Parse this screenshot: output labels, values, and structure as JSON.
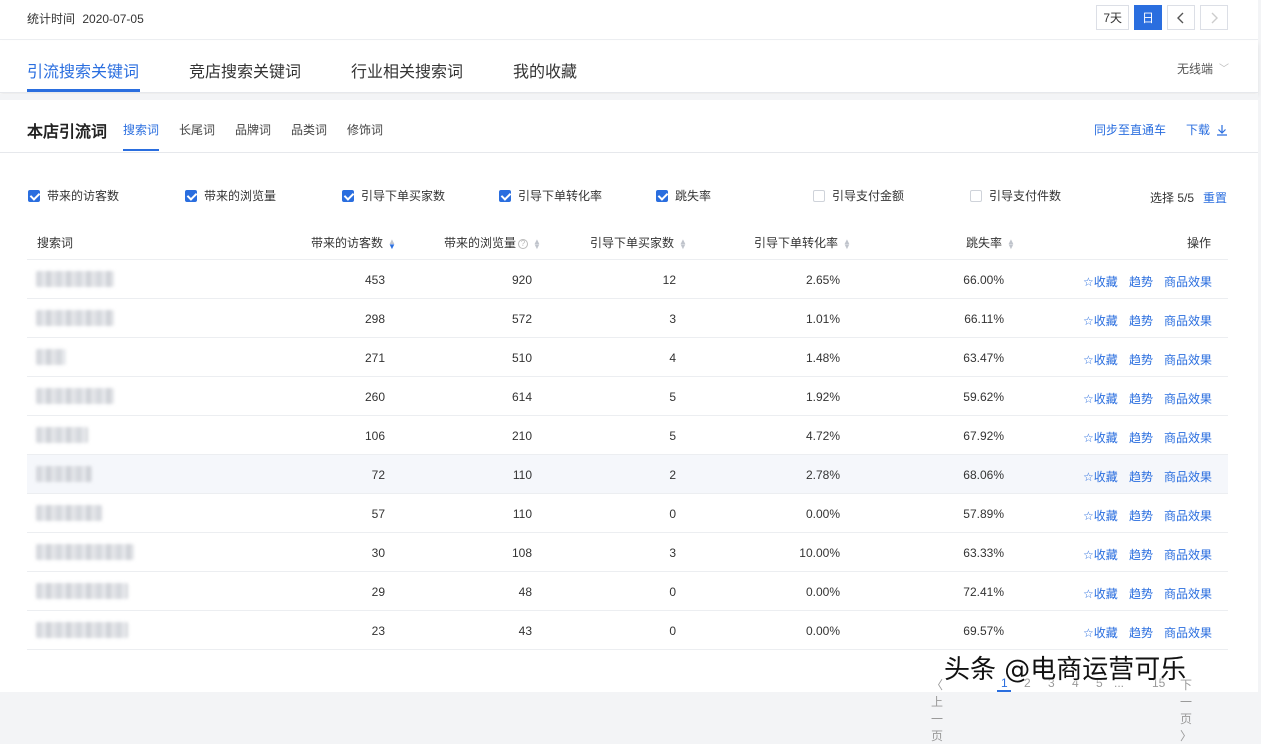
{
  "topbar": {
    "stat_label": "统计时间",
    "stat_date": "2020-07-05",
    "range_buttons": [
      "7天",
      "日"
    ],
    "active_range": "日",
    "prev_icon": "chevron-left-icon",
    "next_icon": "chevron-right-icon"
  },
  "main_tabs": [
    "引流搜索关键词",
    "竞店搜索关键词",
    "行业相关搜索词",
    "我的收藏"
  ],
  "main_tab_active": "引流搜索关键词",
  "device_select": "无线端",
  "section": {
    "title": "本店引流词",
    "tabs": [
      "搜索词",
      "长尾词",
      "品牌词",
      "品类词",
      "修饰词"
    ],
    "active_tab": "搜索词",
    "sync_link": "同步至直通车",
    "download_link": "下载"
  },
  "metrics": [
    {
      "label": "带来的访客数",
      "checked": true
    },
    {
      "label": "带来的浏览量",
      "checked": true
    },
    {
      "label": "引导下单买家数",
      "checked": true
    },
    {
      "label": "引导下单转化率",
      "checked": true
    },
    {
      "label": "跳失率",
      "checked": true
    },
    {
      "label": "引导支付金额",
      "checked": false
    },
    {
      "label": "引导支付件数",
      "checked": false
    }
  ],
  "select_info": "选择 5/5",
  "reset_link": "重置",
  "columns": [
    "搜索词",
    "带来的访客数",
    "带来的浏览量",
    "引导下单买家数",
    "引导下单转化率",
    "跳失率",
    "操作"
  ],
  "rows": [
    {
      "visitors": "453",
      "pv": "920",
      "buyers": "12",
      "conv": "2.65%",
      "bounce": "66.00%"
    },
    {
      "visitors": "298",
      "pv": "572",
      "buyers": "3",
      "conv": "1.01%",
      "bounce": "66.11%"
    },
    {
      "visitors": "271",
      "pv": "510",
      "buyers": "4",
      "conv": "1.48%",
      "bounce": "63.47%"
    },
    {
      "visitors": "260",
      "pv": "614",
      "buyers": "5",
      "conv": "1.92%",
      "bounce": "59.62%"
    },
    {
      "visitors": "106",
      "pv": "210",
      "buyers": "5",
      "conv": "4.72%",
      "bounce": "67.92%"
    },
    {
      "visitors": "72",
      "pv": "110",
      "buyers": "2",
      "conv": "2.78%",
      "bounce": "68.06%"
    },
    {
      "visitors": "57",
      "pv": "110",
      "buyers": "0",
      "conv": "0.00%",
      "bounce": "57.89%"
    },
    {
      "visitors": "30",
      "pv": "108",
      "buyers": "3",
      "conv": "10.00%",
      "bounce": "63.33%"
    },
    {
      "visitors": "29",
      "pv": "48",
      "buyers": "0",
      "conv": "0.00%",
      "bounce": "72.41%"
    },
    {
      "visitors": "23",
      "pv": "43",
      "buyers": "0",
      "conv": "0.00%",
      "bounce": "69.57%"
    }
  ],
  "row_actions": {
    "favorite": "☆收藏",
    "trend": "趋势",
    "product": "商品效果"
  },
  "pagination": {
    "prev": "〈 上一页",
    "pages": [
      "1",
      "2",
      "3",
      "4",
      "5"
    ],
    "ellipsis": "...",
    "last": "15",
    "next": "下一页 〉",
    "current": "1"
  },
  "watermark": "头条 @电商运营可乐"
}
